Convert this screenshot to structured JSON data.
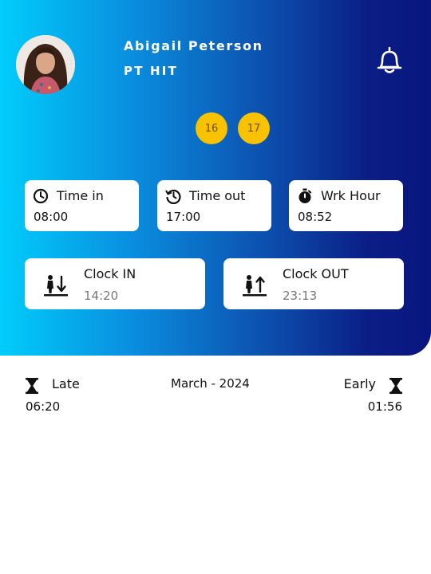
{
  "profile": {
    "name": "Abigail Peterson",
    "role": "PT HIT"
  },
  "days": [
    "16",
    "17"
  ],
  "info_cards": [
    {
      "icon": "clock-icon",
      "label": "Time in",
      "value": "08:00"
    },
    {
      "icon": "history-icon",
      "label": "Time out",
      "value": "17:00"
    },
    {
      "icon": "stopwatch-icon",
      "label": "Wrk Hour",
      "value": "08:52"
    }
  ],
  "clock_in": {
    "icon": "clock-in-icon",
    "label": "Clock IN",
    "value": "14:20"
  },
  "clock_out": {
    "icon": "clock-out-icon",
    "label": "Clock OUT",
    "value": "23:13"
  },
  "stats": {
    "late_label": "Late",
    "late_value": "06:20",
    "month": "March - 2024",
    "early_label": "Early",
    "early_value": "01:56"
  },
  "colors": {
    "gradient_start": "#00cdfa",
    "gradient_end": "#0a1580",
    "chip": "#f8c200",
    "card": "#ffffff"
  }
}
